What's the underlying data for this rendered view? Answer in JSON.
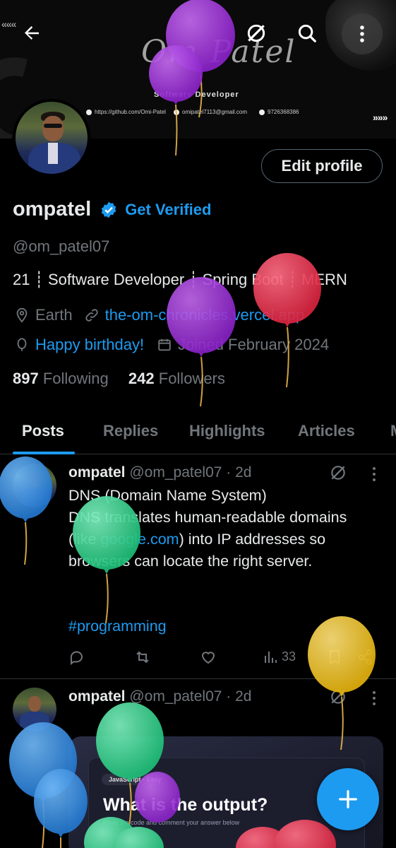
{
  "banner": {
    "signature": "Om Patel",
    "role": "Software Developer",
    "github": "https://github.com/Omi-Patel",
    "email": "omipatel7113@gmail.com",
    "phone": "9726368386",
    "arrows_left": "«««",
    "arrows_right": "»»»"
  },
  "toolbar": {
    "back_icon": "arrow-left-icon",
    "grok_icon": "grok-icon",
    "search_icon": "search-icon",
    "more_icon": "more-vertical-icon"
  },
  "profile": {
    "edit_label": "Edit profile",
    "name": "ompatel",
    "get_verified": "Get Verified",
    "handle": "@om_patel07",
    "bio": "21 ┊ Software Developer ┊ Spring Boot ┊ MERN",
    "location": "Earth",
    "website": "the-om-chronicles.vercel.app",
    "birthday": "Happy birthday!",
    "joined": "Joined February 2024",
    "following_count": "897",
    "following_label": "Following",
    "followers_count": "242",
    "followers_label": "Followers"
  },
  "tabs": [
    {
      "label": "Posts",
      "active": true
    },
    {
      "label": "Replies"
    },
    {
      "label": "Highlights"
    },
    {
      "label": "Articles"
    },
    {
      "label": "M"
    }
  ],
  "posts": [
    {
      "name": "ompatel",
      "meta": "@om_patel07 · 2d",
      "text_line1": "DNS (Domain Name System)",
      "text_pre": "DNS translates human-readable domains (like ",
      "text_link": "google.com",
      "text_post": ") into IP addresses so browsers can locate the right server.",
      "hashtag": "#programming",
      "views": "33"
    },
    {
      "name": "ompatel",
      "meta": "@om_patel07 · 2d",
      "card_chip": "JavaScript • Easy",
      "card_title": "What is the output?",
      "card_sub": "Read the code and comment your answer below"
    }
  ],
  "colors": {
    "accent": "#1d9bf0",
    "balloon_purple": "#9b30d9",
    "balloon_red": "#e8334f",
    "balloon_blue": "#2f8fe0",
    "balloon_green": "#2ed38a",
    "balloon_yellow": "#f0c419"
  }
}
